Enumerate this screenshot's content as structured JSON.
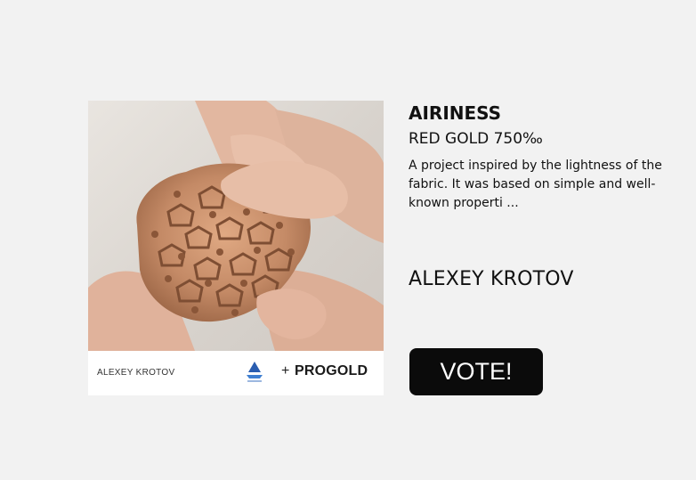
{
  "project": {
    "title": "AIRINESS",
    "material": "RED GOLD 750‰",
    "description": "A project inspired by the lightness of the fabric. It was based on simple and well-known properti ..."
  },
  "author": {
    "name": "ALEXEY KROTOV"
  },
  "image_caption": {
    "author": "ALEXEY KROTOV",
    "plus": "+",
    "partner": "PROGOLD"
  },
  "actions": {
    "vote_label": "VOTE!"
  },
  "colors": {
    "button_bg": "#0b0b0b",
    "page_bg": "#f2f2f2",
    "metal": "#c8906a"
  },
  "icons": {
    "partner_logo": "sail-emblem-icon"
  }
}
